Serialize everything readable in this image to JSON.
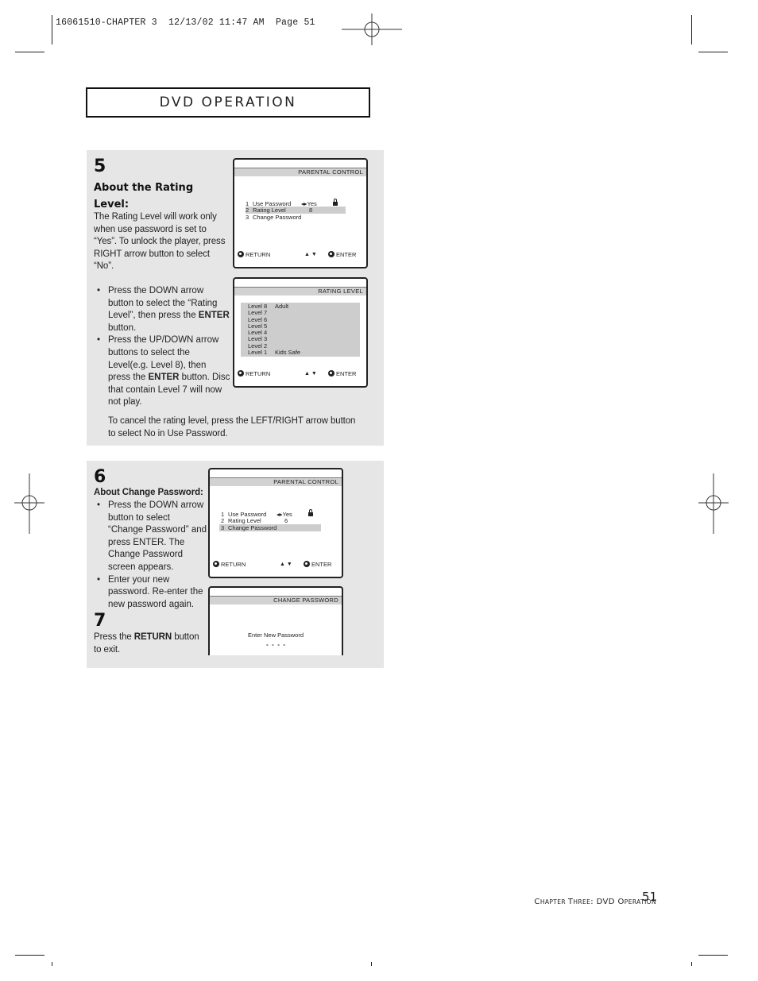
{
  "print_slug": "16061510-CHAPTER 3  12/13/02 11:47 AM  Page 51",
  "section_title": {
    "first": "DVD",
    "cap": "O",
    "rest": "PERATION"
  },
  "step5": {
    "number": "5",
    "heading_line1": "About the Rating",
    "heading_line2": "Level:",
    "intro": "The Rating Level will work only when use password is set to “Yes”. To unlock the player, press RIGHT arrow button to select “No”.",
    "bullets": [
      {
        "pre": "Press the DOWN arrow button to select the “Rating Level”, then press the ",
        "bold": "ENTER",
        "post": " button."
      },
      {
        "pre": "Press the UP/DOWN arrow buttons to select the Level(e.g. Level 8), then press the ",
        "bold": "ENTER",
        "post": " button. Disc that contain Level 7 will now not play."
      }
    ],
    "note": "To cancel the rating level, press the LEFT/RIGHT arrow button to select No in Use Password."
  },
  "screen_parental_1": {
    "title": "PARENTAL  CONTROL",
    "items": [
      {
        "num": "1",
        "label": "Use Password",
        "value": "◂▸Yes",
        "selected": false,
        "lock": true
      },
      {
        "num": "2",
        "label": "Rating Level",
        "value": "8",
        "selected": true,
        "lock": false
      },
      {
        "num": "3",
        "label": "Change Password",
        "value": "",
        "selected": false,
        "lock": false
      }
    ],
    "footer": {
      "return": "RETURN",
      "nav": "▲ ▼",
      "enter": "ENTER"
    }
  },
  "screen_rating": {
    "title": "RATING  LEVEL",
    "levels": [
      {
        "label": "Level  8",
        "desc": "Adult"
      },
      {
        "label": "Level  7",
        "desc": ""
      },
      {
        "label": "Level  6",
        "desc": ""
      },
      {
        "label": "Level  5",
        "desc": ""
      },
      {
        "label": "Level  4",
        "desc": ""
      },
      {
        "label": "Level  3",
        "desc": ""
      },
      {
        "label": "Level  2",
        "desc": ""
      },
      {
        "label": "Level  1",
        "desc": "Kids Safe"
      }
    ],
    "footer": {
      "return": "RETURN",
      "nav": "▲ ▼",
      "enter": "ENTER"
    }
  },
  "step6": {
    "number": "6",
    "heading": "About Change Password:",
    "bullets": [
      "Press the DOWN arrow button to select “Change Password” and press ENTER. The Change Password screen appears.",
      "Enter your new password. Re-enter the new password again."
    ]
  },
  "step7": {
    "number": "7",
    "pre": "Press the ",
    "bold": "RETURN",
    "post": " button to exit."
  },
  "screen_parental_2": {
    "title": "PARENTAL  CONTROL",
    "items": [
      {
        "num": "1",
        "label": "Use Password",
        "value": "◂▸Yes",
        "selected": false,
        "lock": true
      },
      {
        "num": "2",
        "label": "Rating Level",
        "value": "6",
        "selected": false,
        "lock": false
      },
      {
        "num": "3",
        "label": "Change Password",
        "value": "",
        "selected": true,
        "lock": false
      }
    ],
    "footer": {
      "return": "RETURN",
      "nav": "▲ ▼",
      "enter": "ENTER"
    }
  },
  "screen_change_password": {
    "title": "CHANGE PASSWORD",
    "prompt": "Enter New Password",
    "placeholder": "-  -  -  -"
  },
  "footer": {
    "chapter_text": [
      {
        "t": "C",
        "s": "cap"
      },
      {
        "t": "HAPTER ",
        "s": "sm"
      },
      {
        "t": "T",
        "s": "cap"
      },
      {
        "t": "HREE",
        "s": "sm"
      },
      {
        "t": ": DVD ",
        "s": "cap"
      },
      {
        "t": "O",
        "s": "cap"
      },
      {
        "t": "PERATION",
        "s": "sm"
      }
    ],
    "page_number": "51"
  }
}
